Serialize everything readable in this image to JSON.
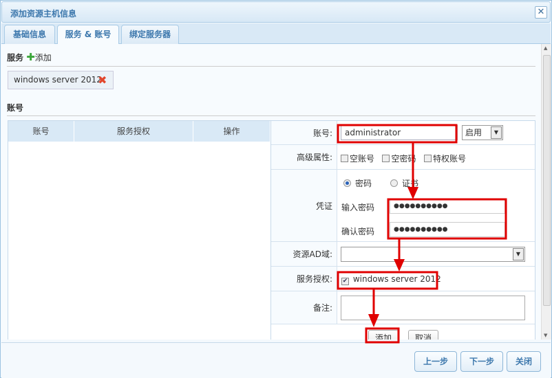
{
  "window": {
    "title": "添加资源主机信息",
    "close_icon": "close-icon"
  },
  "tabs": [
    {
      "label": "基础信息"
    },
    {
      "label": "服务 & 账号",
      "active": true
    },
    {
      "label": "绑定服务器"
    }
  ],
  "services": {
    "heading": "服务",
    "add_label": "添加",
    "items": [
      {
        "name": "windows server 2012"
      }
    ]
  },
  "accounts": {
    "heading": "账号",
    "columns": [
      "账号",
      "服务授权",
      "操作"
    ]
  },
  "form": {
    "account_label": "账号:",
    "account_value": "administrator",
    "status_value": "启用",
    "advanced_label": "高级属性:",
    "advanced_options": [
      "空账号",
      "空密码",
      "特权账号"
    ],
    "credential_label": "凭证",
    "cred_types": [
      "密码",
      "证书"
    ],
    "cred_selected": "密码",
    "password_label": "输入密码",
    "password_value": "●●●●●●●●●●",
    "confirm_label": "确认密码",
    "confirm_value": "●●●●●●●●●●",
    "ad_label": "资源AD域:",
    "ad_value": "",
    "auth_label": "服务授权:",
    "auth_service": "windows server 2012",
    "auth_checked": true,
    "note_label": "备注:",
    "note_value": "",
    "add_button": "添加",
    "cancel_button": "取消"
  },
  "footer": {
    "prev": "上一步",
    "next": "下一步",
    "close": "关闭"
  },
  "colors": {
    "accent": "#3d78ad",
    "annotation": "#e00000"
  }
}
